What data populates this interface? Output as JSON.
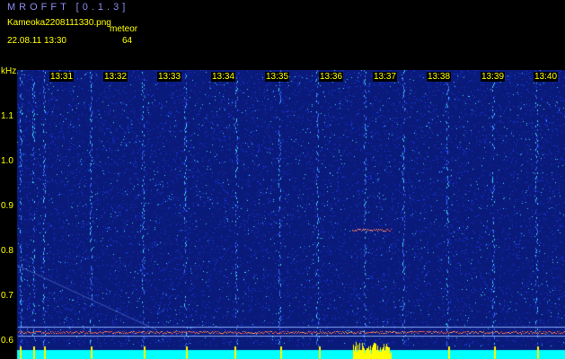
{
  "header": {
    "app_title": "MROFFT [0.1.3]",
    "file_name": "Kameoka2208111330.png",
    "date_time": "22.08.11 13:30",
    "meteor_label": "meteor",
    "meteor_count": "64"
  },
  "spectrogram": {
    "unit": "kHz",
    "time_ticks": [
      "13:31",
      "13:32",
      "13:33",
      "13:34",
      "13:35",
      "13:36",
      "13:37",
      "13:38",
      "13:39",
      "13:40"
    ],
    "freq_ticks": [
      "1.1",
      "1.0",
      "0.9",
      "0.8",
      "0.7",
      "0.6"
    ],
    "colors": {
      "background": "#0a1a7a",
      "noise_low": "#1e3cff",
      "noise_high": "#3fd6ff",
      "carrier": "#ff5040",
      "level_bar": "#00ffff",
      "level_peak": "#ffff00"
    }
  }
}
